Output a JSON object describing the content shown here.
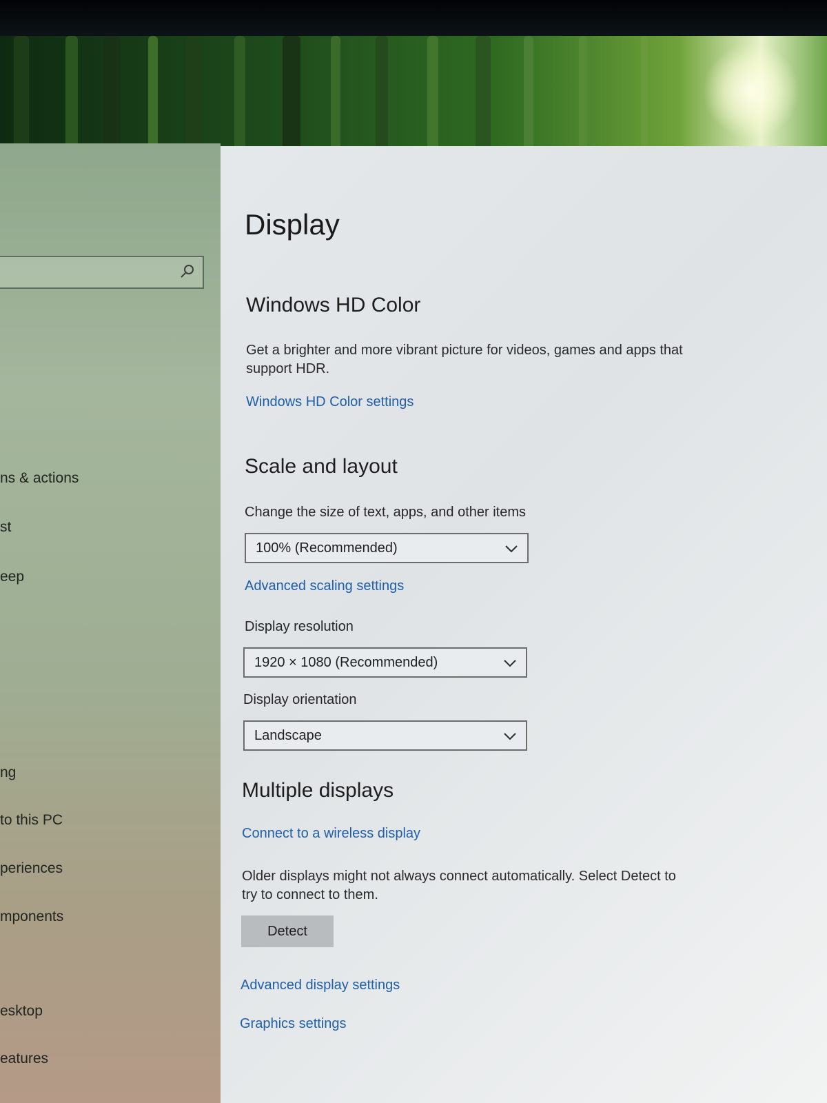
{
  "window": {
    "page_title": "Display"
  },
  "sidebar": {
    "items": [
      {
        "label": "ns & actions"
      },
      {
        "label": "st"
      },
      {
        "label": "eep"
      },
      {
        "label": "ng"
      },
      {
        "label": "to this PC"
      },
      {
        "label": "periences"
      },
      {
        "label": "mponents"
      },
      {
        "label": "esktop"
      },
      {
        "label": "eatures"
      }
    ]
  },
  "hd_color": {
    "heading": "Windows HD Color",
    "description_line1": "Get a brighter and more vibrant picture for videos, games and apps that",
    "description_line2": "support HDR.",
    "settings_link": "Windows HD Color settings"
  },
  "scale_layout": {
    "heading": "Scale and layout",
    "scale_label": "Change the size of text, apps, and other items",
    "scale_value": "100% (Recommended)",
    "advanced_scaling_link": "Advanced scaling settings",
    "resolution_label": "Display resolution",
    "resolution_value": "1920 × 1080 (Recommended)",
    "orientation_label": "Display orientation",
    "orientation_value": "Landscape"
  },
  "multiple_displays": {
    "heading": "Multiple displays",
    "wireless_link": "Connect to a wireless display",
    "info_line1": "Older displays might not always connect automatically. Select Detect to",
    "info_line2": "try to connect to them.",
    "detect_button": "Detect",
    "advanced_display_link": "Advanced display settings",
    "graphics_link": "Graphics settings"
  },
  "icons": {
    "search": "search-icon",
    "dropdown": "chevron-down-icon"
  },
  "colors": {
    "link": "#1f5ea8",
    "button": "#b9bcbe",
    "sidebar": "#a4b69d"
  }
}
